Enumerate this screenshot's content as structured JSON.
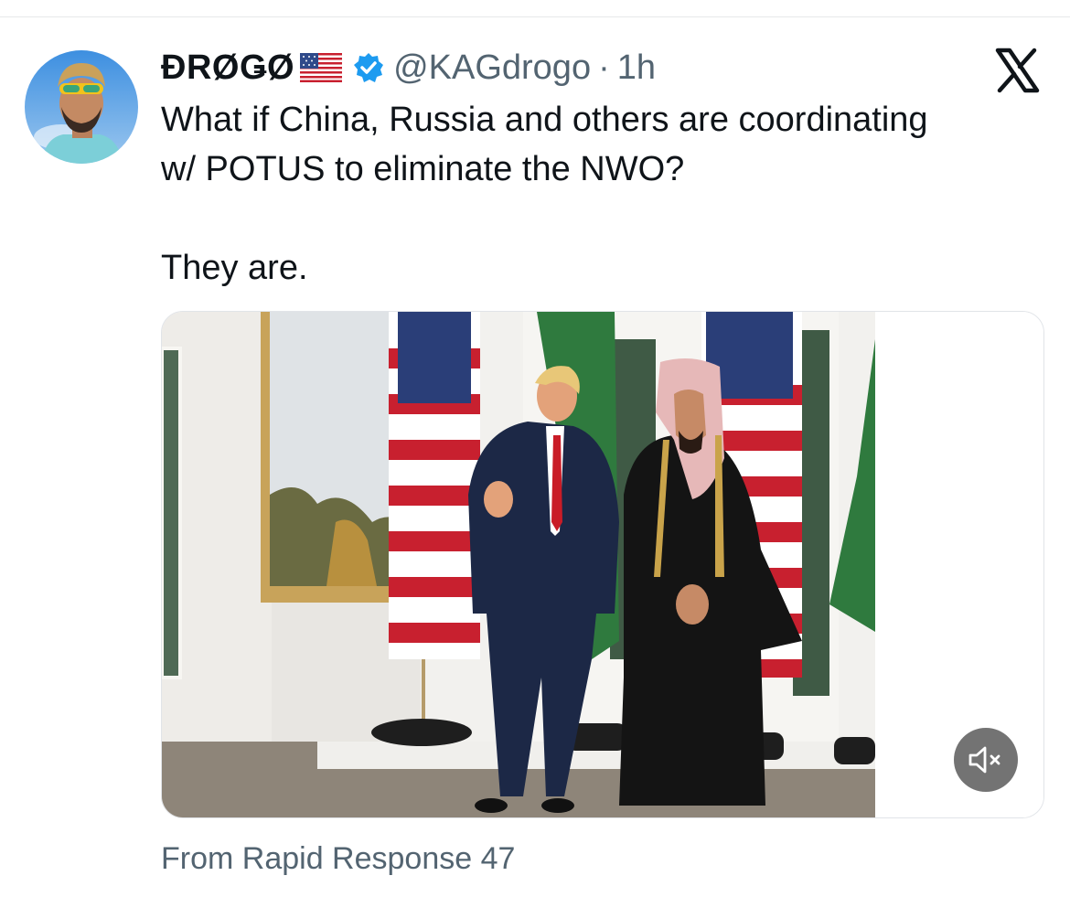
{
  "tweet": {
    "display_name": "ĐRØǤØ",
    "name_emoji": "us-flag",
    "verified": true,
    "handle": "@KAGdrogo",
    "separator": "·",
    "time": "1h",
    "text_lines": [
      "What if China, Russia and others are coordinating",
      "w/ POTUS to eliminate the NWO?"
    ],
    "text_second_paragraph": "They are.",
    "media": {
      "type": "video",
      "muted": true,
      "mute_icon": "speaker-muted-icon"
    },
    "source": "From Rapid Response 47"
  },
  "icons": {
    "platform_logo": "x-logo-icon",
    "verified_badge": "verified-check-icon"
  },
  "colors": {
    "text": "#0f1419",
    "muted_text": "#536471",
    "verified_blue": "#1d9bf0"
  }
}
